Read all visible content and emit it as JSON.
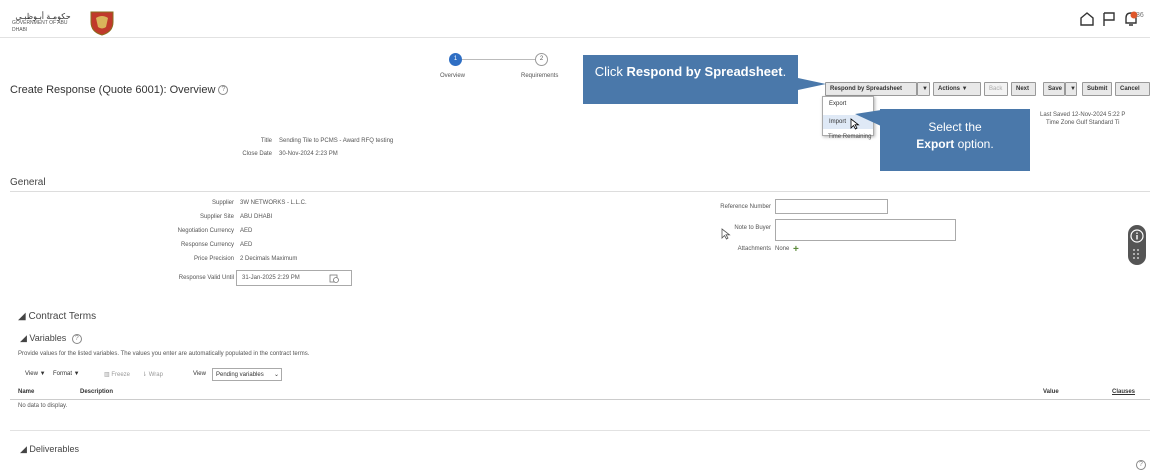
{
  "header": {
    "logo_arabic": "حكومـة أبـوظبـي",
    "logo_english": "GOVERNMENT OF ABU DHABI",
    "user": "36"
  },
  "train": {
    "steps": [
      {
        "number": "1",
        "label": "Overview"
      },
      {
        "number": "2",
        "label": "Requirements"
      }
    ]
  },
  "page": {
    "title": "Create Response (Quote 6001): Overview",
    "help": "?"
  },
  "toolbar": {
    "respond_spreadsheet": "Respond by Spreadsheet",
    "actions": "Actions",
    "back": "Back",
    "next": "Next",
    "save": "Save",
    "submit": "Submit",
    "cancel": "Cancel",
    "dropdown_items": [
      "Export",
      "Import"
    ]
  },
  "saved": {
    "line1": "Last Saved 12-Nov-2024 5:22 P",
    "line2": "Time Zone Gulf Standard Ti",
    "remaining": "Time Remaining"
  },
  "callouts": {
    "one_prefix": "Click ",
    "one_bold": "Respond by Spreadsheet",
    "one_suffix": ".",
    "two_prefix": "Select the ",
    "two_bold": "Export",
    "two_suffix": " option."
  },
  "summary": {
    "title_label": "Title",
    "title_value": "Sending Tile to PCMS - Award RFQ testing",
    "close_label": "Close Date",
    "close_value": "30-Nov-2024 2:23 PM"
  },
  "general": {
    "heading": "General",
    "supplier_label": "Supplier",
    "supplier_value": "3W NETWORKS - L.L.C.",
    "site_label": "Supplier Site",
    "site_value": "ABU DHABI",
    "neg_currency_label": "Negotiation Currency",
    "neg_currency_value": "AED",
    "resp_currency_label": "Response Currency",
    "resp_currency_value": "AED",
    "precision_label": "Price Precision",
    "precision_value": "2 Decimals Maximum",
    "valid_label": "Response Valid Until",
    "valid_value": "31-Jan-2025 2:29 PM",
    "ref_label": "Reference Number",
    "note_label": "Note to Buyer",
    "attach_label": "Attachments",
    "attach_value": "None"
  },
  "contract": {
    "heading": "Contract Terms",
    "variables_heading": "Variables",
    "instructions": "Provide values for the listed variables. The values you enter are automatically populated in the contract terms.",
    "view": "View",
    "format": "Format",
    "freeze": "Freeze",
    "wrap": "Wrap",
    "view_label": "View",
    "view_select": "Pending variables",
    "columns": [
      "Name",
      "Description",
      "Value",
      "Clauses"
    ],
    "no_data": "No data to display.",
    "deliverables": "Deliverables"
  },
  "colors": {
    "callout": "#4a78aa",
    "step_active": "#2f6fc4"
  }
}
